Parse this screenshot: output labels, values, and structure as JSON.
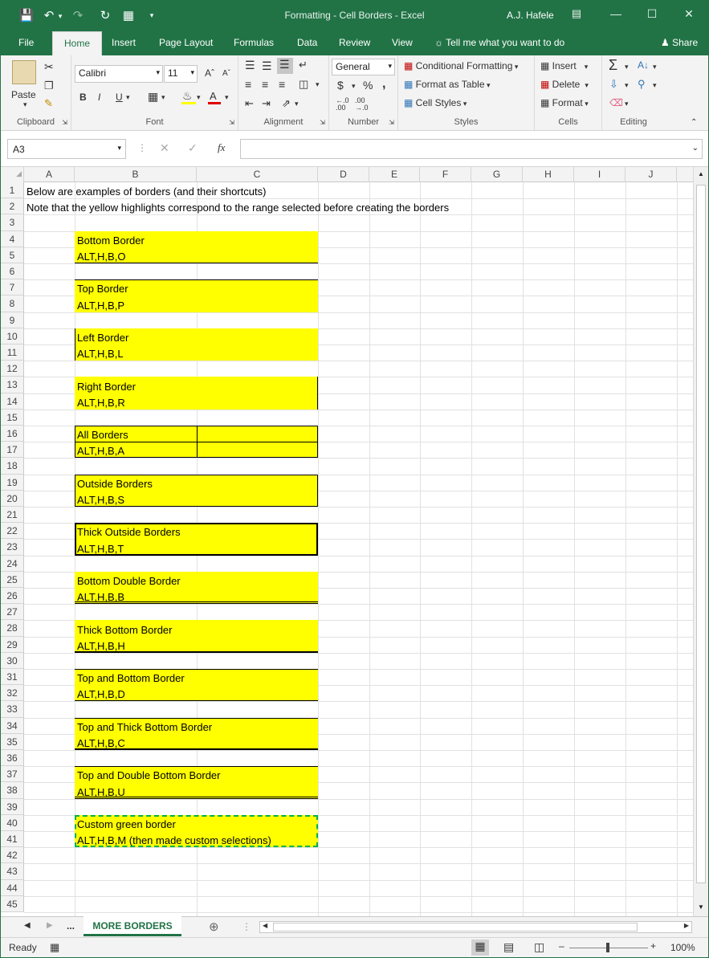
{
  "title_bar": {
    "title": "Formatting - Cell Borders  -  Excel",
    "user": "A.J. Hafele"
  },
  "menu_tabs": [
    "File",
    "Home",
    "Insert",
    "Page Layout",
    "Formulas",
    "Data",
    "Review",
    "View"
  ],
  "tell_me": "Tell me what you want to do",
  "share": "Share",
  "ribbon": {
    "clipboard": {
      "paste": "Paste",
      "label": "Clipboard"
    },
    "font": {
      "name": "Calibri",
      "size": "11",
      "label": "Font",
      "bold": "B",
      "italic": "I",
      "underline": "U"
    },
    "alignment": {
      "label": "Alignment"
    },
    "number": {
      "format": "General",
      "currency": "$",
      "percent": "%",
      "comma": ",",
      "label": "Number"
    },
    "styles": {
      "conditional": "Conditional Formatting",
      "table": "Format as Table",
      "cell_styles": "Cell Styles",
      "label": "Styles"
    },
    "cells": {
      "insert": "Insert",
      "delete": "Delete",
      "format": "Format",
      "label": "Cells"
    },
    "editing": {
      "label": "Editing"
    }
  },
  "formula_bar": {
    "name_box": "A3",
    "fx": "fx",
    "value": ""
  },
  "columns": [
    "A",
    "B",
    "C",
    "D",
    "E",
    "F",
    "G",
    "H",
    "I",
    "J"
  ],
  "rows": [
    "1",
    "2",
    "3",
    "4",
    "5",
    "6",
    "7",
    "8",
    "9",
    "10",
    "11",
    "12",
    "13",
    "14",
    "15",
    "16",
    "17",
    "18",
    "19",
    "20",
    "21",
    "22",
    "23",
    "24",
    "25",
    "26",
    "27",
    "28",
    "29",
    "30",
    "31",
    "32",
    "33",
    "34",
    "35",
    "36",
    "37",
    "38",
    "39",
    "40",
    "41",
    "42",
    "43",
    "44",
    "45"
  ],
  "cells": {
    "r1": "Below are examples of borders (and their shortcuts)",
    "r2": "Note that the yellow highlights correspond to the range selected before creating the borders",
    "r4": "Bottom Border",
    "r5": "ALT,H,B,O",
    "r7": "Top Border",
    "r8": "ALT,H,B,P",
    "r10": "Left Border",
    "r11": "ALT,H,B,L",
    "r13": "Right Border",
    "r14": "ALT,H,B,R",
    "r16": "All Borders",
    "r17": "ALT,H,B,A",
    "r19": "Outside Borders",
    "r20": "ALT,H,B,S",
    "r22": "Thick Outside Borders",
    "r23": "ALT,H,B,T",
    "r25": "Bottom Double Border",
    "r26": "ALT,H,B,B",
    "r28": "Thick Bottom Border",
    "r29": "ALT,H,B,H",
    "r31": "Top and Bottom Border",
    "r32": "ALT,H,B,D",
    "r34": "Top and Thick Bottom Border",
    "r35": "ALT,H,B,C",
    "r37": "Top and Double Bottom Border",
    "r38": "ALT,H,B,U",
    "r40": "Custom green border",
    "r41": "ALT,H,B,M (then made custom selections)"
  },
  "sheet_tabs": {
    "ellipsis": "...",
    "active": "MORE BORDERS"
  },
  "status": {
    "ready": "Ready",
    "zoom": "100%"
  },
  "colors": {
    "excel_green": "#217346",
    "highlight": "#ffff00",
    "custom_border": "#00b050"
  }
}
